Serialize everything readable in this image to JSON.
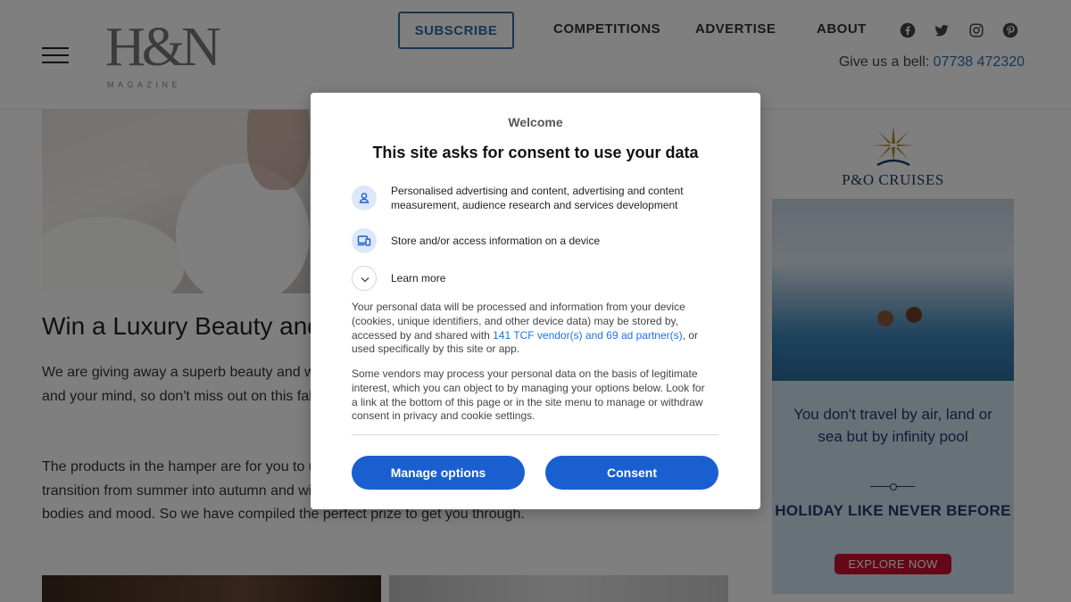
{
  "header": {
    "logo_mark": "H&N",
    "logo_sub": "MAGAZINE",
    "nav": {
      "subscribe": "SUBSCRIBE",
      "competitions": "COMPETITIONS",
      "advertise": "ADVERTISE",
      "about": "ABOUT"
    },
    "social_icons": [
      "facebook-icon",
      "twitter-icon",
      "instagram-icon",
      "pinterest-icon"
    ],
    "bell_label": "Give us a bell:",
    "bell_phone": "07738 472320"
  },
  "article": {
    "title": "Win a Luxury Beauty and Wellness Hamper",
    "para1": "We are giving away a superb beauty and wellness hamper full of treats for your face, your hair, your body and your mind, so don't miss out on this fabulous giveaway.",
    "para2": "The products in the hamper are for you to use as the seasons change, and to prepare yourself for the transition from summer into autumn and winter. We all know the cold weather can play havoc with our bodies and mood. So we have compiled the perfect prize to get you through."
  },
  "ad": {
    "brand": "P&O CRUISES",
    "tagline": "You don't travel by air, land or sea but by infinity pool",
    "headline": "HOLIDAY LIKE NEVER BEFORE",
    "cta": "EXPLORE NOW"
  },
  "consent": {
    "welcome": "Welcome",
    "title": "This site asks for consent to use your data",
    "purposes": [
      {
        "icon": "person-icon",
        "text": "Personalised advertising and content, advertising and content measurement, audience research and services development"
      },
      {
        "icon": "devices-icon",
        "text": "Store and/or access information on a device"
      },
      {
        "icon": "chevron-down-icon",
        "text": "Learn more"
      }
    ],
    "body1_a": "Your personal data will be processed and information from your device (cookies, unique identifiers, and other device data) may be stored by, accessed by and shared with ",
    "body1_link": "141 TCF vendor(s) and 69 ad partner(s)",
    "body1_b": ", or used specifically by this site or app.",
    "body2": "Some vendors may process your personal data on the basis of legitimate interest, which you can object to by managing your options below. Look for a link at the bottom of this page or in the site menu to manage or withdraw consent in privacy and cookie settings.",
    "manage_label": "Manage options",
    "consent_label": "Consent"
  },
  "colors": {
    "accent": "#1a5fd0",
    "link": "#1a73e8",
    "brand_blue": "#2b6ea8",
    "ad_navy": "#1f3a6e",
    "ad_red": "#c8102e"
  }
}
